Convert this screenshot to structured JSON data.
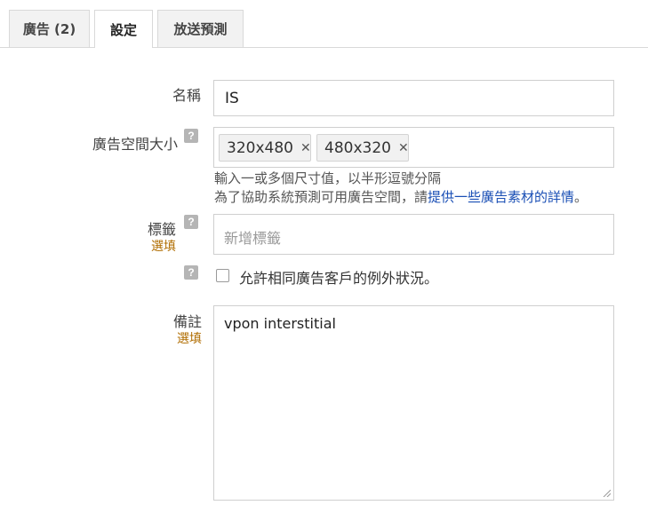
{
  "tabs": [
    {
      "label": "廣告 (2)",
      "active": false
    },
    {
      "label": "設定",
      "active": true
    },
    {
      "label": "放送預測",
      "active": false
    }
  ],
  "form": {
    "name": {
      "label": "名稱",
      "value": "IS"
    },
    "ad_space_size": {
      "label": "廣告空間大小",
      "chips": [
        "320x480",
        "480x320"
      ],
      "chip_remove_glyph": "✕",
      "hint_line1": "輸入一或多個尺寸值，以半形逗號分隔",
      "hint_line2_prefix": "為了協助系統預測可用廣告空間，請",
      "hint_line2_link": "提供一些廣告素材的詳情",
      "hint_line2_suffix": "。"
    },
    "labels": {
      "label": "標籤",
      "optional": "選填",
      "placeholder": "新增標籤"
    },
    "exception": {
      "checkbox_label": "允許相同廣告客戶的例外狀況。",
      "checked": false
    },
    "notes": {
      "label": "備註",
      "optional": "選填",
      "value": "vpon interstitial"
    }
  },
  "icons": {
    "help": "?",
    "help_icon_name": "help-icon"
  },
  "colors": {
    "link": "#1a4fb5",
    "optional": "#b06d00",
    "tab_bg": "#f2f2f2"
  }
}
